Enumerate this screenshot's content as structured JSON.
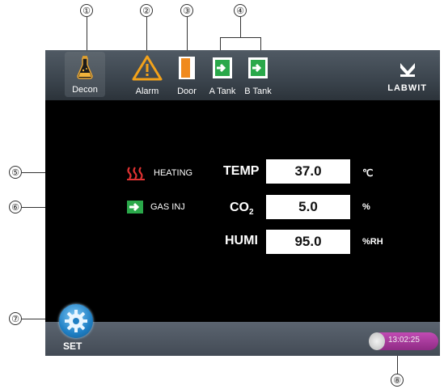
{
  "callouts": [
    "①",
    "②",
    "③",
    "④",
    "⑤",
    "⑥",
    "⑦",
    "⑧"
  ],
  "topbar": {
    "decon": "Decon",
    "alarm": "Alarm",
    "door": "Door",
    "a_tank": "A Tank",
    "b_tank": "B Tank",
    "brand": "LABWIT"
  },
  "status": {
    "heating": "HEATING",
    "gas_inj": "GAS INJ"
  },
  "params": {
    "temp": {
      "label": "TEMP",
      "value": "37.0",
      "unit": "℃"
    },
    "co2": {
      "label": "CO",
      "sub": "2",
      "value": "5.0",
      "unit": "%"
    },
    "humi": {
      "label": "HUMI",
      "value": "95.0",
      "unit": "%RH"
    }
  },
  "bottombar": {
    "set": "SET",
    "time": "13:02:25"
  },
  "colors": {
    "alarm": "#f3a21a",
    "door": "#f08a1e",
    "tank": "#2aa84a",
    "heating": "#e03232",
    "set": "#1f7fc4",
    "clock": "#b23ea6"
  }
}
